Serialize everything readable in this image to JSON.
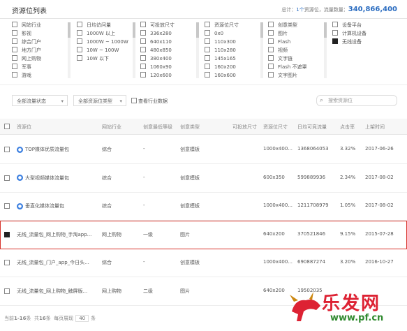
{
  "header": {
    "title": "资源位列表",
    "summary_prefix": "总计：",
    "summary_count": "1个",
    "summary_mid": "资源位，流量数量：",
    "summary_total": "340,866,400"
  },
  "filters": {
    "col1": [
      "网站行业",
      "影视",
      "综合门户",
      "地方门户",
      "网上购物",
      "军事",
      "游戏"
    ],
    "col2": [
      "日均访问量",
      "1000W 以上",
      "1000W ~ 1000W",
      "10W ~ 100W",
      "10W 以下"
    ],
    "col3": [
      "可投放尺寸",
      "336x280",
      "640x110",
      "480x850",
      "380x400",
      "1060x90",
      "120x600"
    ],
    "col4": [
      "资源位尺寸",
      "0x0",
      "110x300",
      "110x280",
      "145x165",
      "160x200",
      "160x600"
    ],
    "col5": [
      "创意类型",
      "图片",
      "Flash",
      "视频",
      "文字链",
      "Flash 不遮罩",
      "文字图片"
    ],
    "col6": [
      "设备平台",
      "计算机设备",
      "无线设备"
    ]
  },
  "toolbar": {
    "status_select": "全部流量状态",
    "type_select": "全部资源位类型",
    "industry_checkbox": "查看行业数据",
    "search_placeholder": "搜索资源位"
  },
  "table": {
    "headers": [
      "资源位",
      "网站行业",
      "创意最低等级",
      "创意类型",
      "可投放尺寸",
      "资源位尺寸",
      "日均可竞流量",
      "点击率",
      "上架时间"
    ],
    "rows": [
      {
        "name": "TOP媒体优质流量包",
        "industry": "综合",
        "level": "-",
        "ctype": "创意模板",
        "size": "",
        "rsize": "1000x400...",
        "traffic": "1368064053",
        "ctr": "3.32%",
        "date": "2017-06-26"
      },
      {
        "name": "大型视频媒体流量包",
        "industry": "综合",
        "level": "-",
        "ctype": "创意模板",
        "size": "",
        "rsize": "600x350",
        "traffic": "599889936",
        "ctr": "2.34%",
        "date": "2017-08-02"
      },
      {
        "name": "垂直化媒体流量包",
        "industry": "综合",
        "level": "-",
        "ctype": "创意模板",
        "size": "",
        "rsize": "1000x400...",
        "traffic": "1211708979",
        "ctr": "1.05%",
        "date": "2017-08-02"
      },
      {
        "name": "无线_流量包_网上购物_手淘app...",
        "industry": "网上购物",
        "level": "一级",
        "ctype": "图片",
        "size": "",
        "rsize": "640x200",
        "traffic": "370521846",
        "ctr": "9.15%",
        "date": "2015-07-28"
      },
      {
        "name": "无线_流量包_门户_app_今日头...",
        "industry": "综合",
        "level": "-",
        "ctype": "创意模板",
        "size": "",
        "rsize": "1000x400...",
        "traffic": "690887274",
        "ctr": "3.20%",
        "date": "2016-10-27"
      },
      {
        "name": "无线_流量包_网上购物_触屏版...",
        "industry": "网上购物",
        "level": "二级",
        "ctype": "图片",
        "size": "",
        "rsize": "640x200",
        "traffic": "19502035",
        "ctr": "",
        "date": ""
      }
    ]
  },
  "footer": {
    "range_prefix": "当前",
    "range": "1-16",
    "range_suffix": "条",
    "total_prefix": "共",
    "total": "16",
    "total_suffix": "条",
    "per_page_label": "每页展现",
    "per_page": "40",
    "per_page_suffix": "条"
  },
  "watermark": {
    "text": "乐发网",
    "url": "www.pf.cn"
  },
  "colors": {
    "accent": "#2a6cc0",
    "selected_outline": "#d8342c",
    "icon_blue": "#3b7fe0"
  },
  "selected_row_index": 3,
  "checked_filters": {
    "col6": [
      2
    ]
  }
}
